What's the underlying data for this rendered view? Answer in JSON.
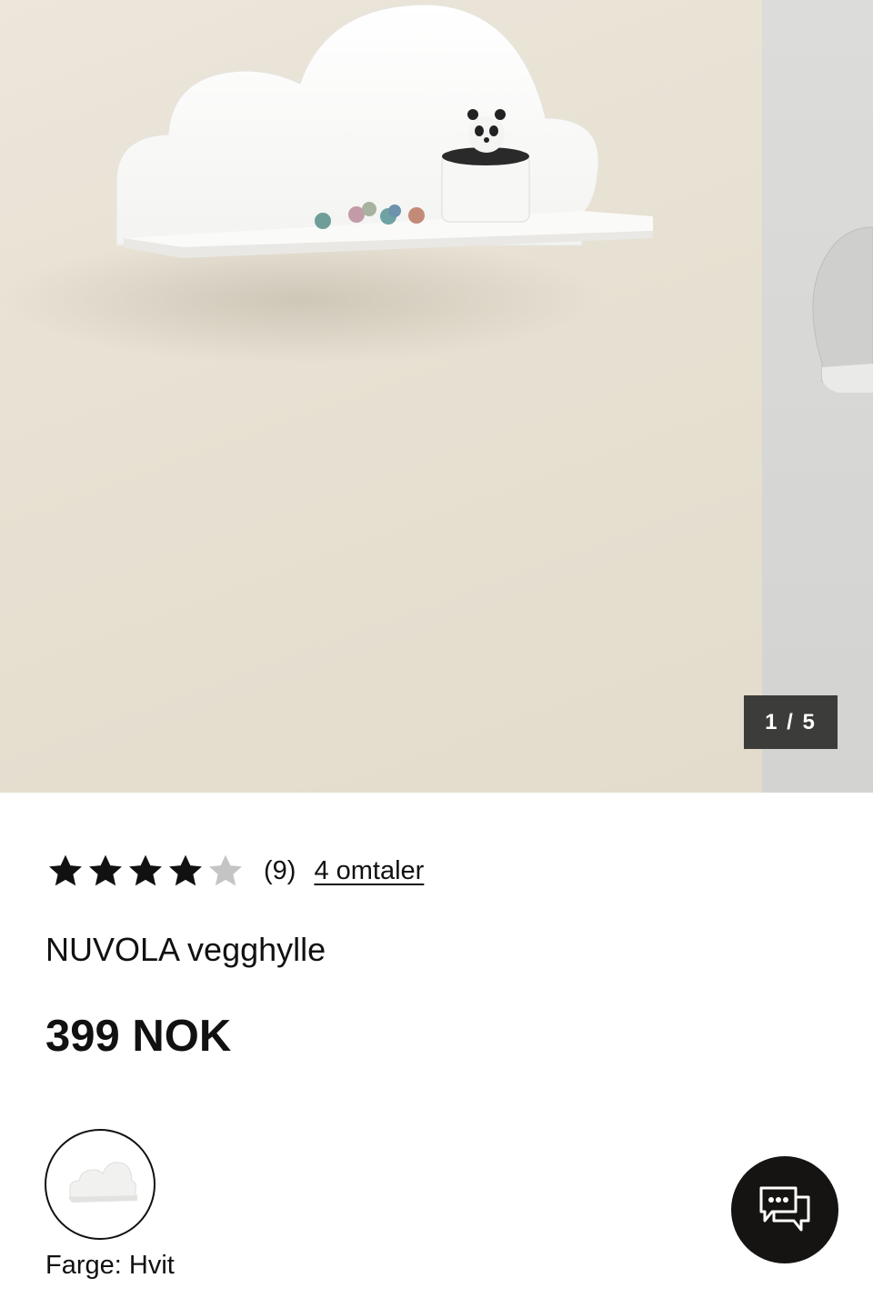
{
  "gallery": {
    "counter": "1 / 5",
    "main_image_alt": "NUVOLA vegghylle",
    "next_image_alt": "NUVOLA vegghylle"
  },
  "rating": {
    "stars_filled": 4,
    "stars_total": 5,
    "count": "(9)",
    "reviews_link": "4 omtaler"
  },
  "product": {
    "title": "NUVOLA vegghylle",
    "price": "399 NOK"
  },
  "variant": {
    "color_label": "Farge: Hvit",
    "swatch_alt": "Hvit"
  },
  "chat": {
    "label": "Chat"
  },
  "colors": {
    "star_filled": "#111111",
    "star_empty": "#c4c4c4",
    "counter_bg": "#3c3c3a",
    "chat_bg": "#161413"
  }
}
